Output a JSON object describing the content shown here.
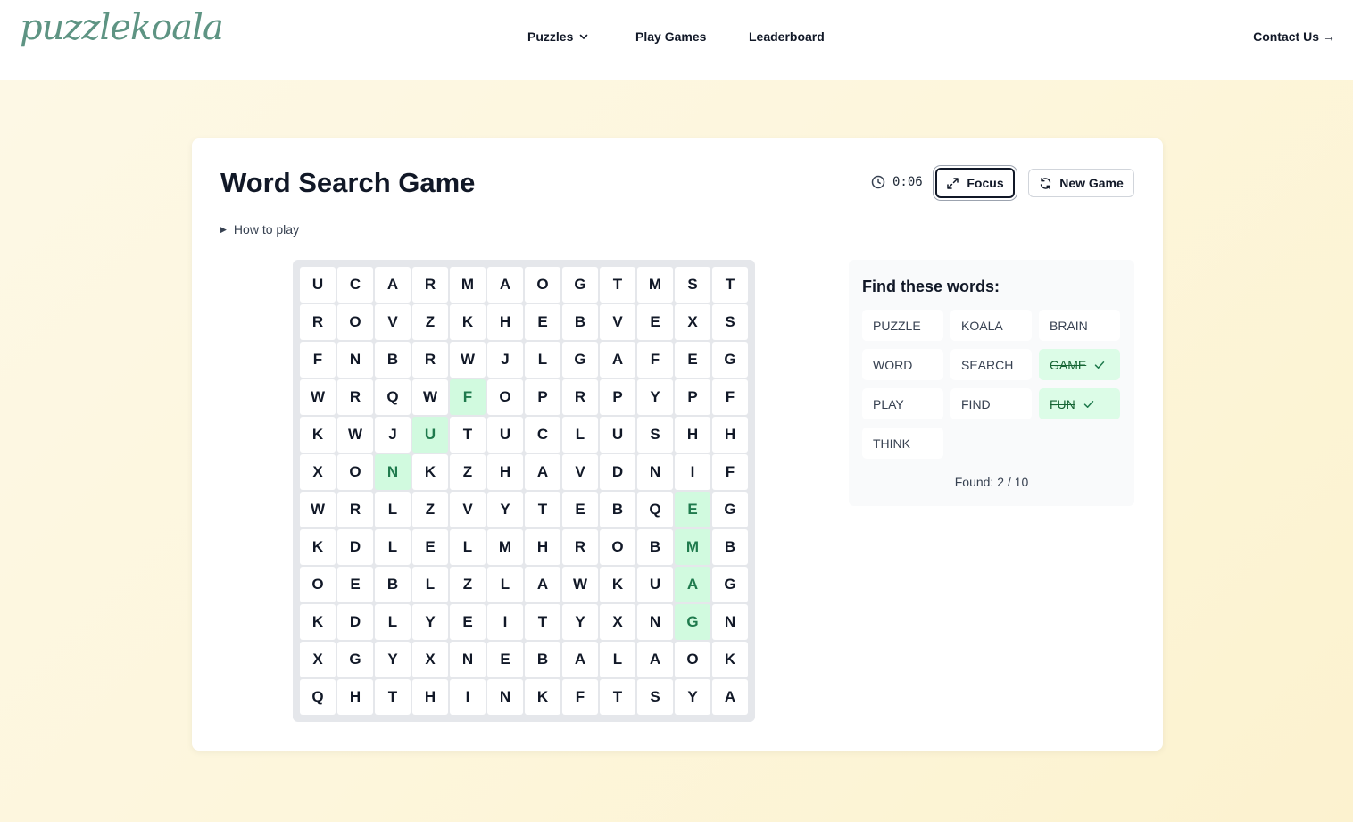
{
  "header": {
    "logo": "puzzlekoala",
    "nav": {
      "puzzles": "Puzzles",
      "play_games": "Play Games",
      "leaderboard": "Leaderboard"
    },
    "contact": "Contact Us",
    "contact_arrow": "→"
  },
  "game": {
    "title": "Word Search Game",
    "timer": "0:06",
    "focus_label": "Focus",
    "new_game_label": "New Game",
    "how_to_play": "How to play"
  },
  "grid": {
    "rows": [
      [
        "U",
        "C",
        "A",
        "R",
        "M",
        "A",
        "O",
        "G",
        "T",
        "M",
        "S",
        "T"
      ],
      [
        "R",
        "O",
        "V",
        "Z",
        "K",
        "H",
        "E",
        "B",
        "V",
        "E",
        "X",
        "S"
      ],
      [
        "F",
        "N",
        "B",
        "R",
        "W",
        "J",
        "L",
        "G",
        "A",
        "F",
        "E",
        "G"
      ],
      [
        "W",
        "R",
        "Q",
        "W",
        "F",
        "O",
        "P",
        "R",
        "P",
        "Y",
        "P",
        "F"
      ],
      [
        "K",
        "W",
        "J",
        "U",
        "T",
        "U",
        "C",
        "L",
        "U",
        "S",
        "H",
        "H"
      ],
      [
        "X",
        "O",
        "N",
        "K",
        "Z",
        "H",
        "A",
        "V",
        "D",
        "N",
        "I",
        "F"
      ],
      [
        "W",
        "R",
        "L",
        "Z",
        "V",
        "Y",
        "T",
        "E",
        "B",
        "Q",
        "E",
        "G"
      ],
      [
        "K",
        "D",
        "L",
        "E",
        "L",
        "M",
        "H",
        "R",
        "O",
        "B",
        "M",
        "B"
      ],
      [
        "O",
        "E",
        "B",
        "L",
        "Z",
        "L",
        "A",
        "W",
        "K",
        "U",
        "A",
        "G"
      ],
      [
        "K",
        "D",
        "L",
        "Y",
        "E",
        "I",
        "T",
        "Y",
        "X",
        "N",
        "G",
        "N"
      ],
      [
        "X",
        "G",
        "Y",
        "X",
        "N",
        "E",
        "B",
        "A",
        "L",
        "A",
        "O",
        "K"
      ],
      [
        "Q",
        "H",
        "T",
        "H",
        "I",
        "N",
        "K",
        "F",
        "T",
        "S",
        "Y",
        "A"
      ]
    ],
    "found_cells": [
      [
        3,
        4
      ],
      [
        4,
        3
      ],
      [
        5,
        2
      ],
      [
        6,
        10
      ],
      [
        7,
        10
      ],
      [
        8,
        10
      ],
      [
        9,
        10
      ]
    ]
  },
  "words_panel": {
    "title": "Find these words:",
    "words": [
      {
        "text": "PUZZLE",
        "found": false
      },
      {
        "text": "KOALA",
        "found": false
      },
      {
        "text": "BRAIN",
        "found": false
      },
      {
        "text": "WORD",
        "found": false
      },
      {
        "text": "SEARCH",
        "found": false
      },
      {
        "text": "GAME",
        "found": true
      },
      {
        "text": "PLAY",
        "found": false
      },
      {
        "text": "FIND",
        "found": false
      },
      {
        "text": "FUN",
        "found": true
      },
      {
        "text": "THINK",
        "found": false
      }
    ],
    "found_count": "Found: 2 / 10"
  },
  "colors": {
    "found_bg": "#d1fadf",
    "found_text": "#1f7a4d",
    "logo": "#5e9483"
  }
}
